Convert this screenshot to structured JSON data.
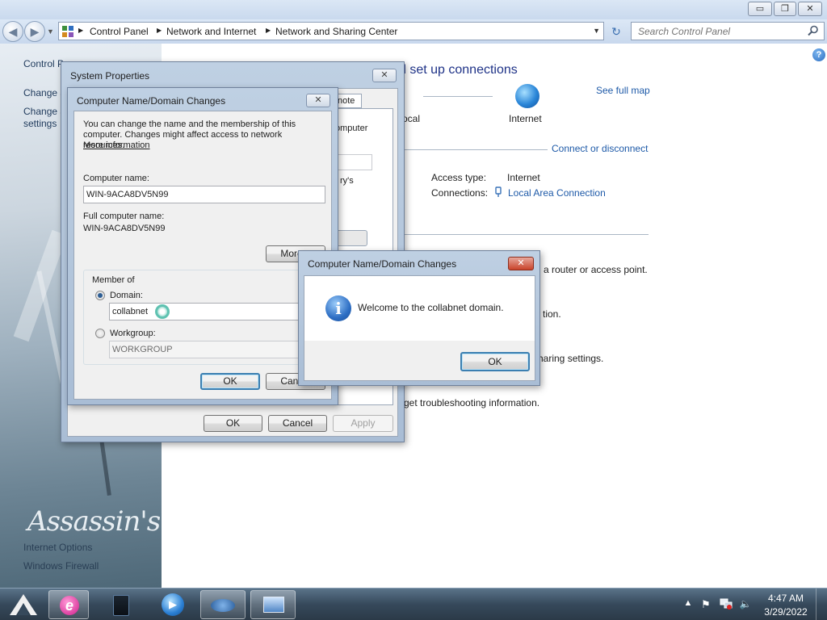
{
  "explorer": {
    "window_buttons": {
      "minimize": "▭",
      "maximize": "❐",
      "close": "✕"
    },
    "breadcrumbs": [
      "Control Panel",
      "Network and Internet",
      "Network and Sharing Center"
    ],
    "search_placeholder": "Search Control Panel"
  },
  "left_panel": {
    "links": [
      "Control P",
      "Change a",
      "Change a",
      "settings",
      "Internet Options",
      "Windows Firewall"
    ],
    "wallpaper_text": "Assassin's Creed"
  },
  "content": {
    "heading": "d set up connections",
    "see_full_map": "See full map",
    "internet_label": "Internet",
    "local_fragment": "ocal",
    "connect_link": "Connect or disconnect",
    "access_type_label": "Access type:",
    "access_type_value": "Internet",
    "connections_label": "Connections:",
    "connections_value": "Local Area Connection",
    "fragment_router": "a router or access point.",
    "fragment_tion": "tion.",
    "fragment_sharing": "haring settings.",
    "fragment_troubleshoot": "get troubleshooting information."
  },
  "system_properties": {
    "title": "System Properties",
    "close": "✕",
    "tab_fragment": "note",
    "fragment_computer": "omputer",
    "fragment_ys": "ry's",
    "ok": "OK",
    "cancel": "Cancel",
    "apply": "Apply"
  },
  "name_changes": {
    "title": "Computer Name/Domain Changes",
    "close": "✕",
    "intro": "You can change the name and the membership of this computer. Changes might affect access to network resources.",
    "more_information": "More information",
    "computer_name_label": "Computer name:",
    "computer_name_value": "WIN-9ACA8DV5N99",
    "full_name_label": "Full computer name:",
    "full_name_value": "WIN-9ACA8DV5N99",
    "more_button": "More...",
    "member_of": "Member of",
    "domain_label": "Domain:",
    "domain_value": "collabnet",
    "workgroup_label": "Workgroup:",
    "workgroup_value": "WORKGROUP",
    "ok": "OK",
    "cancel": "Cancel"
  },
  "welcome_dialog": {
    "title": "Computer Name/Domain Changes",
    "close": "✕",
    "message": "Welcome to the collabnet domain.",
    "info_glyph": "i",
    "ok": "OK"
  },
  "taskbar": {
    "time": "4:47 AM",
    "date": "3/29/2022"
  },
  "colors": {
    "link": "#1e5aa8",
    "heading": "#1e3287",
    "default_button_border": "#3c7fb1",
    "close_red": "#c9432a",
    "taskbar": "#36495b"
  }
}
